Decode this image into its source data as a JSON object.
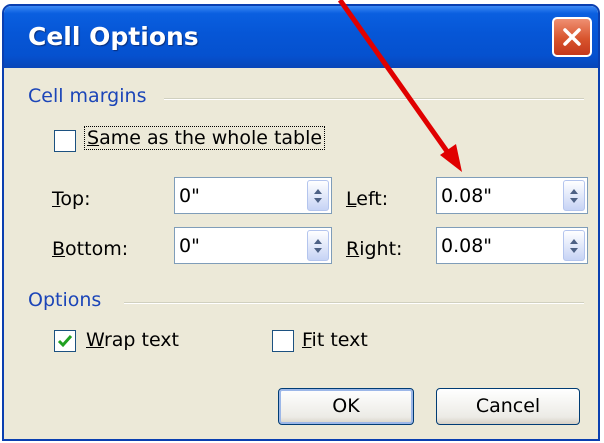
{
  "dialog": {
    "title": "Cell Options",
    "close_label": "Close"
  },
  "cell_margins": {
    "section_label": "Cell margins",
    "same_as_table": {
      "label": "Same as the whole table",
      "mnemonic": "S",
      "rest": "ame as the whole table",
      "checked": false
    },
    "fields": [
      {
        "key": "top",
        "mnemonic": "T",
        "rest": "op:",
        "value": "0\""
      },
      {
        "key": "bottom",
        "mnemonic": "B",
        "rest": "ottom:",
        "value": "0\""
      },
      {
        "key": "left",
        "mnemonic": "L",
        "rest": "eft:",
        "value": "0.08\""
      },
      {
        "key": "right",
        "mnemonic": "R",
        "rest": "ight:",
        "value": "0.08\""
      }
    ]
  },
  "options": {
    "section_label": "Options",
    "wrap_text": {
      "mnemonic": "W",
      "rest": "rap text",
      "checked": true
    },
    "fit_text": {
      "mnemonic": "F",
      "rest": "it text",
      "checked": false
    }
  },
  "buttons": {
    "ok": "OK",
    "cancel": "Cancel"
  },
  "annotation": {
    "arrow_color": "#e00000"
  }
}
